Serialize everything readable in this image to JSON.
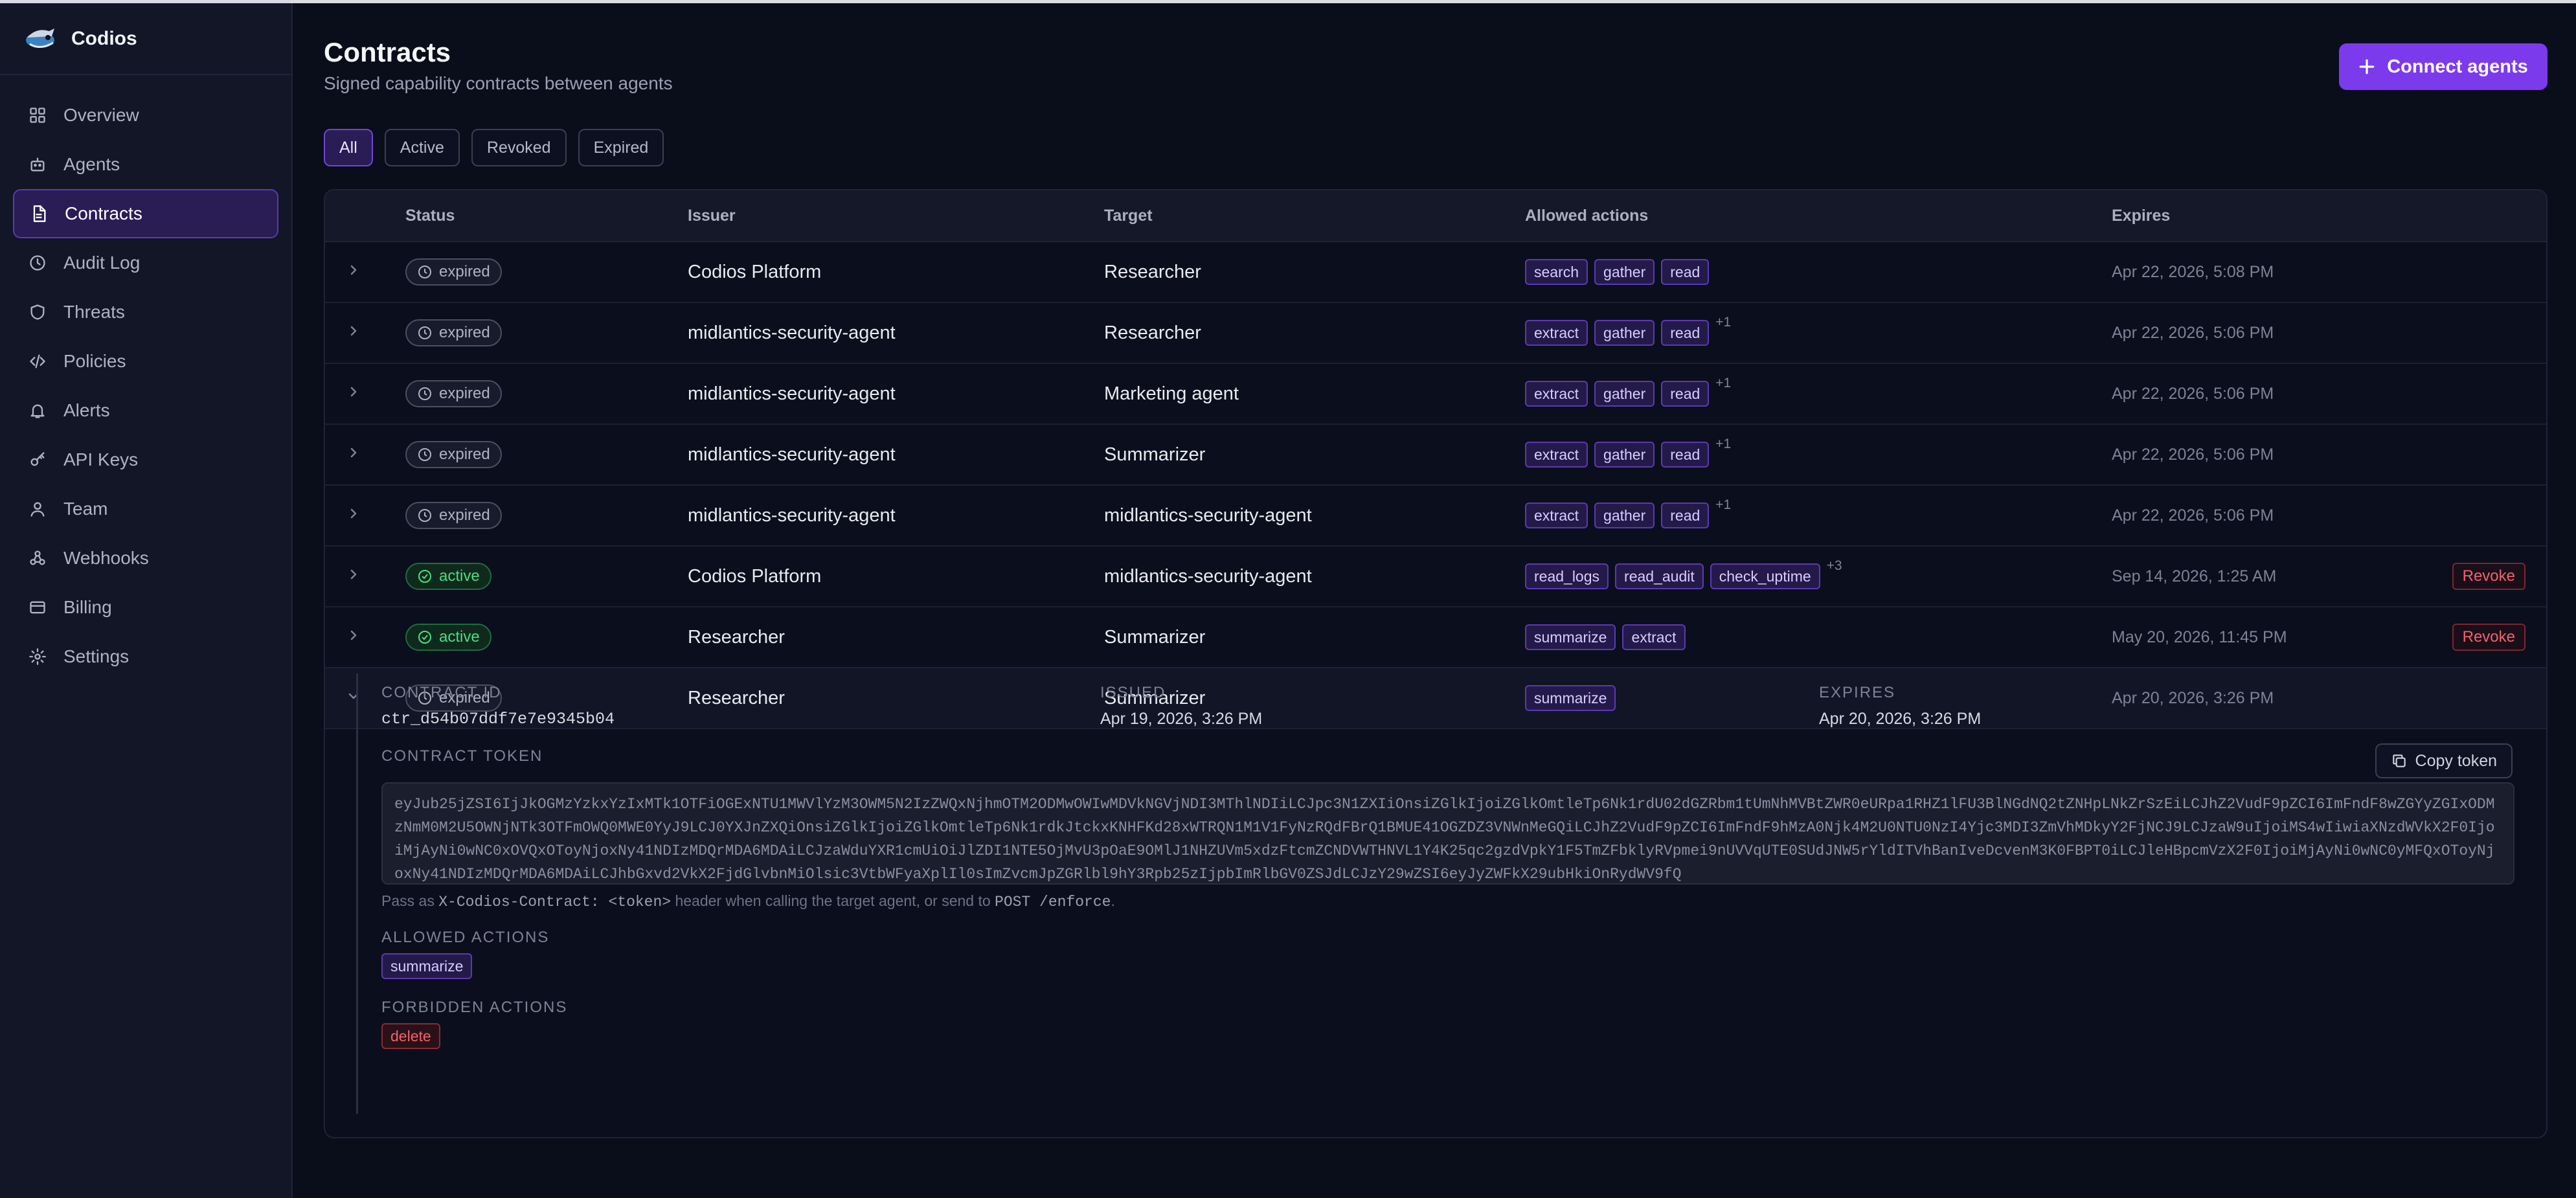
{
  "app": {
    "name": "Codios"
  },
  "sidebar": {
    "items": [
      {
        "label": "Overview",
        "icon": "grid-icon"
      },
      {
        "label": "Agents",
        "icon": "bot-icon"
      },
      {
        "label": "Contracts",
        "icon": "document-icon",
        "active": true
      },
      {
        "label": "Audit Log",
        "icon": "clock-icon"
      },
      {
        "label": "Threats",
        "icon": "shield-icon"
      },
      {
        "label": "Policies",
        "icon": "code-icon"
      },
      {
        "label": "Alerts",
        "icon": "bell-icon"
      },
      {
        "label": "API Keys",
        "icon": "key-icon"
      },
      {
        "label": "Team",
        "icon": "user-icon"
      },
      {
        "label": "Webhooks",
        "icon": "webhook-icon"
      },
      {
        "label": "Billing",
        "icon": "card-icon"
      },
      {
        "label": "Settings",
        "icon": "gear-icon"
      }
    ]
  },
  "header": {
    "title": "Contracts",
    "subtitle": "Signed capability contracts between agents",
    "connect_label": "Connect agents"
  },
  "filters": [
    "All",
    "Active",
    "Revoked",
    "Expired"
  ],
  "table": {
    "columns": [
      "Status",
      "Issuer",
      "Target",
      "Allowed actions",
      "Expires"
    ],
    "rows": [
      {
        "status": "expired",
        "issuer": "Codios Platform",
        "target": "Researcher",
        "actions": [
          "search",
          "gather",
          "read"
        ],
        "more": "",
        "expires": "Apr 22, 2026, 5:08 PM",
        "revoke": ""
      },
      {
        "status": "expired",
        "issuer": "midlantics-security-agent",
        "target": "Researcher",
        "actions": [
          "extract",
          "gather",
          "read"
        ],
        "more": "+1",
        "expires": "Apr 22, 2026, 5:06 PM",
        "revoke": ""
      },
      {
        "status": "expired",
        "issuer": "midlantics-security-agent",
        "target": "Marketing agent",
        "actions": [
          "extract",
          "gather",
          "read"
        ],
        "more": "+1",
        "expires": "Apr 22, 2026, 5:06 PM",
        "revoke": ""
      },
      {
        "status": "expired",
        "issuer": "midlantics-security-agent",
        "target": "Summarizer",
        "actions": [
          "extract",
          "gather",
          "read"
        ],
        "more": "+1",
        "expires": "Apr 22, 2026, 5:06 PM",
        "revoke": ""
      },
      {
        "status": "expired",
        "issuer": "midlantics-security-agent",
        "target": "midlantics-security-agent",
        "actions": [
          "extract",
          "gather",
          "read"
        ],
        "more": "+1",
        "expires": "Apr 22, 2026, 5:06 PM",
        "revoke": ""
      },
      {
        "status": "active",
        "issuer": "Codios Platform",
        "target": "midlantics-security-agent",
        "actions": [
          "read_logs",
          "read_audit",
          "check_uptime"
        ],
        "more": "+3",
        "expires": "Sep 14, 2026, 1:25 AM",
        "revoke": "Revoke"
      },
      {
        "status": "active",
        "issuer": "Researcher",
        "target": "Summarizer",
        "actions": [
          "summarize",
          "extract"
        ],
        "more": "",
        "expires": "May 20, 2026, 11:45 PM",
        "revoke": "Revoke"
      },
      {
        "status": "expired",
        "issuer": "Researcher",
        "target": "Summarizer",
        "actions": [
          "summarize"
        ],
        "more": "",
        "expires": "Apr 20, 2026, 3:26 PM",
        "revoke": "",
        "expanded": true
      }
    ]
  },
  "details": {
    "contract_id_label": "CONTRACT ID",
    "contract_id": "ctr_d54b07ddf7e7e9345b04",
    "issued_label": "ISSUED",
    "issued": "Apr 19, 2026, 3:26 PM",
    "expires_label": "EXPIRES",
    "expires": "Apr 20, 2026, 3:26 PM",
    "token_label": "CONTRACT TOKEN",
    "copy_label": "Copy token",
    "token": "eyJub25jZSI6IjJkOGMzYzkxYzIxMTk1OTFiOGExNTU1MWVlYzM3OWM5N2IzZWQxNjhmOTM2ODMwOWIwMDVkNGVjNDI3MThlNDIiLCJpc3N1ZXIiOnsiZGlkIjoiZGlkOmtleTp6Nk1rdU02dGZRbm1tUmNhMVBtZWR0eURpa1RHZ1lFU3BlNGdNQ2tZNHpLNkZrSzEiLCJhZ2VudF9pZCI6ImFndF8wZGYyZGIxODMzNmM0M2U5OWNjNTk3OTFmOWQ0MWE0YyJ9LCJ0YXJnZXQiOnsiZGlkIjoiZGlkOmtleTp6Nk1rdkJtckxKNHFKd28xWTRQN1M1V1FyNzRQdFBrQ1BMUE41OGZDZ3VNWnMeGQiLCJhZ2VudF9pZCI6ImFndF9hMzA0Njk4M2U0NTU0NzI4Yjc3MDI3ZmVhMDkyY2FjNCJ9LCJzaW9uIjoiMS4wIiwiaXNzdWVkX2F0IjoiMjAyNi0wNC0xOVQxOToyNjoxNy41NDIzMDQrMDA6MDAiLCJzaWduYXR1cmUiOiJlZDI1NTE5OjMvU3pOaE9OMlJ1NHZUVm5xdzFtcmZCNDVWTHNVL1Y4K25qc2gzdVpkY1F5TmZFbklyRVpmei9nUVVqUTE0SUdJNW5rYldITVhBanIveDcvenM3K0FBPT0iLCJleHBpcmVzX2F0IjoiMjAyNi0wNC0yMFQxOToyNjoxNy41NDIzMDQrMDA6MDAiLCJhbGxvd2VkX2FjdGlvbnMiOlsic3VtbWFyaXplIl0sImZvcmJpZGRlbl9hY3Rpb25zIjpbImRlbGV0ZSJdLCJzY29wZSI6eyJyZWFkX29ubHkiOnRydWV9fQ",
    "hint_prefix": "Pass as ",
    "hint_header": "X-Codios-Contract: <token>",
    "hint_mid": " header when calling the target agent, or send to ",
    "hint_endpoint": "POST /enforce",
    "hint_suffix": ".",
    "allowed_label": "ALLOWED ACTIONS",
    "allowed": [
      "summarize"
    ],
    "forbidden_label": "FORBIDDEN ACTIONS",
    "forbidden": [
      "delete"
    ]
  },
  "colors": {
    "accent": "#7c3aed",
    "background": "#0a0d1a",
    "active_status": "#4ade80",
    "danger": "#f2626f"
  }
}
